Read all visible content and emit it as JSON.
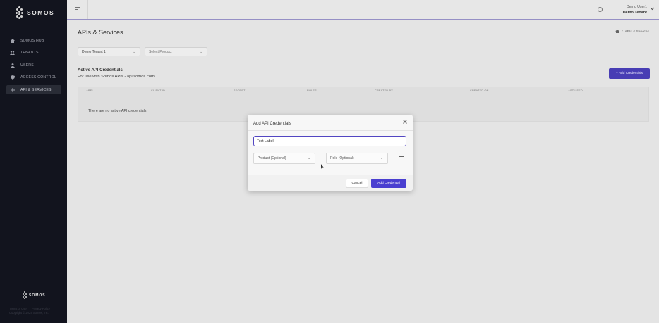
{
  "sidebar": {
    "brand": "SOMOS",
    "items": [
      {
        "label": "SOMOS HUB",
        "icon": "home-icon"
      },
      {
        "label": "TENANTS",
        "icon": "users-group-icon"
      },
      {
        "label": "USERS",
        "icon": "user-icon"
      },
      {
        "label": "ACCESS CONTROL",
        "icon": "shield-icon"
      },
      {
        "label": "API & SERVICES",
        "icon": "plug-icon"
      }
    ],
    "footer_brand": "SOMOS",
    "footer_links": [
      "Terms of Use",
      "Privacy Policy"
    ],
    "copyright": "Copyright © 2024 Somos, Inc."
  },
  "topbar": {
    "user_name": "Demo User1",
    "tenant_name": "Demo Tenant"
  },
  "page": {
    "title": "APIs & Services",
    "breadcrumb_sep": "/",
    "breadcrumb_current": "APIs & Services",
    "tenant_select": "Demo Tenant 1",
    "product_select_placeholder": "Select Product",
    "section_title": "Active API Credentials",
    "section_subtitle": "For use with Somos APIs - api.somos.com",
    "add_credentials_button": "+ Add Credentials",
    "table_headers": [
      "LABEL",
      "CLIENT ID",
      "SECRET",
      "ROLES",
      "CREATED BY",
      "CREATED ON",
      "LAST USED"
    ],
    "empty_message": "There are no active API credentials."
  },
  "modal": {
    "title": "Add API Credentials",
    "label_value": "Test Label",
    "product_placeholder": "Product (Optional)",
    "role_placeholder": "Role (Optional)",
    "cancel_label": "Cancel",
    "submit_label": "Add Credential"
  },
  "colors": {
    "sidebar_bg": "#13151f",
    "accent": "#4a3fd0",
    "page_bg": "#e9e9e9"
  }
}
